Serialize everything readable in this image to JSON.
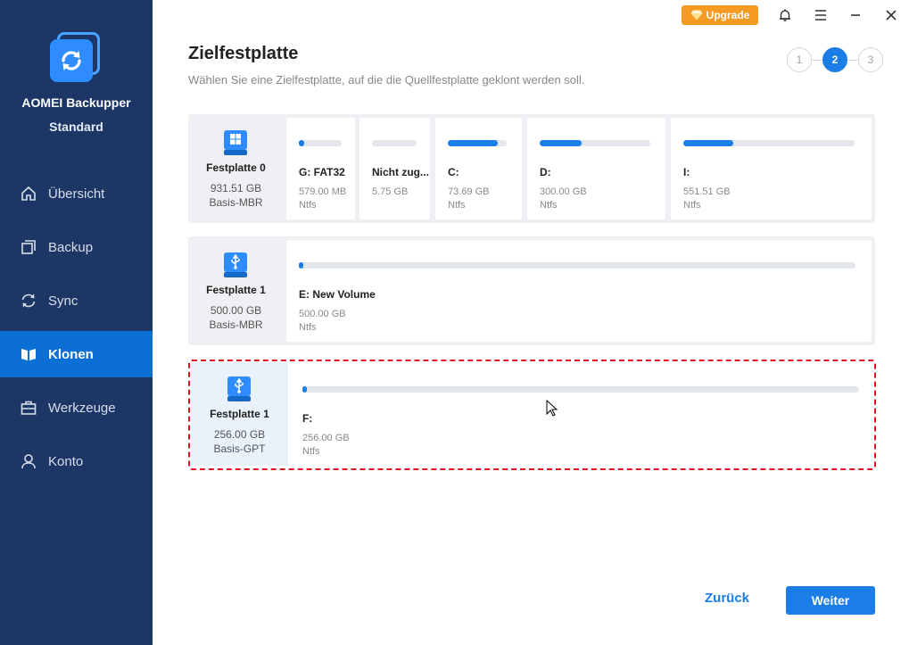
{
  "app": {
    "name": "AOMEI Backupper",
    "edition": "Standard"
  },
  "nav": [
    {
      "label": "Übersicht",
      "icon": "home-icon",
      "active": false
    },
    {
      "label": "Backup",
      "icon": "backup-icon",
      "active": false
    },
    {
      "label": "Sync",
      "icon": "sync-icon",
      "active": false
    },
    {
      "label": "Klonen",
      "icon": "clone-icon",
      "active": true
    },
    {
      "label": "Werkzeuge",
      "icon": "tools-icon",
      "active": false
    },
    {
      "label": "Konto",
      "icon": "user-icon",
      "active": false
    }
  ],
  "titlebar": {
    "upgrade_label": "Upgrade"
  },
  "page": {
    "title": "Zielfestplatte",
    "subtitle": "Wählen Sie eine Zielfestplatte, auf die die Quellfestplatte geklont werden soll."
  },
  "steps": {
    "labels": [
      "1",
      "2",
      "3"
    ],
    "current": 2
  },
  "disks": [
    {
      "name": "Festplatte 0",
      "size": "931.51 GB",
      "type": "Basis-MBR",
      "icon": "windows-disk-icon",
      "partitions": [
        {
          "name": "G: FAT32",
          "size": "579.00 MB",
          "fs": "Ntfs",
          "used": 0.12
        },
        {
          "name": "Nicht zug...",
          "size": "5.75 GB",
          "fs": "",
          "used": 0
        },
        {
          "name": "C:",
          "size": "73.69 GB",
          "fs": "Ntfs",
          "used": 0.85
        },
        {
          "name": "D:",
          "size": "300.00 GB",
          "fs": "Ntfs",
          "used": 0.38
        },
        {
          "name": "I:",
          "size": "551.51 GB",
          "fs": "Ntfs",
          "used": 0.29
        }
      ]
    },
    {
      "name": "Festplatte 1",
      "size": "500.00 GB",
      "type": "Basis-MBR",
      "icon": "usb-disk-icon",
      "partitions": [
        {
          "name": "E: New Volume",
          "size": "500.00 GB",
          "fs": "Ntfs",
          "used": 0.005
        }
      ]
    },
    {
      "name": "Festplatte 1",
      "size": "256.00 GB",
      "type": "Basis-GPT",
      "icon": "usb-disk-icon",
      "selected": true,
      "partitions": [
        {
          "name": "F:",
          "size": "256.00 GB",
          "fs": "Ntfs",
          "used": 0.005
        }
      ]
    }
  ],
  "buttons": {
    "back": "Zurück",
    "next": "Weiter"
  },
  "colors": {
    "sidebar": "#1c3766",
    "accent": "#1a7ee6",
    "upgrade": "#f59a23",
    "selection": "#e0121f"
  }
}
